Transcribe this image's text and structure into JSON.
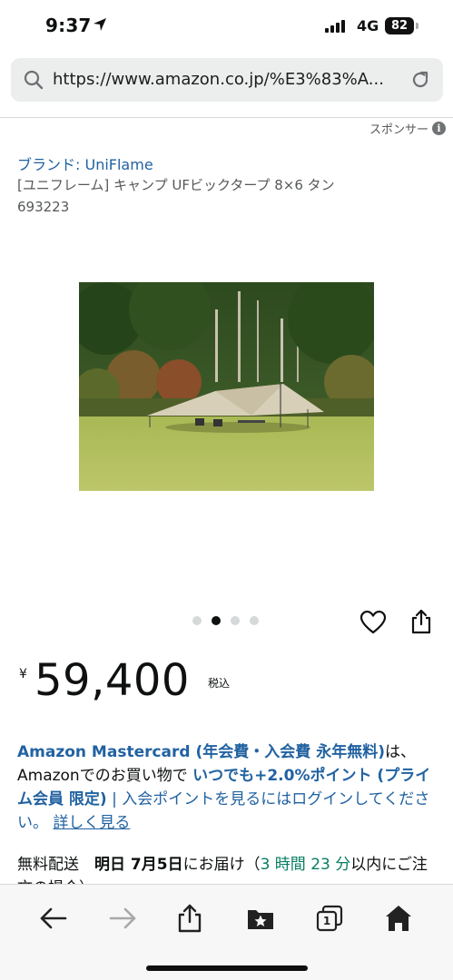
{
  "status_bar": {
    "time": "9:37",
    "network": "4G",
    "battery": "82"
  },
  "browser": {
    "url": "https://www.amazon.co.jp/%E3%83%A..."
  },
  "sponsor": {
    "label": "スポンサー",
    "info_glyph": "i"
  },
  "product": {
    "brand_link": "ブランド: UniFlame",
    "title_line1": "[ユニフレーム] キャンプ UFビックタープ 8×6 タン",
    "title_line2": "693223",
    "image_count": 4,
    "active_image": 2
  },
  "price": {
    "symbol": "¥",
    "amount": "59,400",
    "tax_note": "税込"
  },
  "promo": {
    "part1": "Amazon Mastercard (年会費・入会費 永年無料)",
    "part2": "は、Amazonでのお買い物で ",
    "part3": "いつでも+2.0%ポイント (プライム会員 限定)",
    "part4": " | 入会ポイントを見るにはログインしてください。 ",
    "link": "詳しく見る"
  },
  "delivery": {
    "label": "無料配送　",
    "date": "明日 7月5日",
    "suffix": "にお届け（",
    "countdown": "3 時間 23 分",
    "tail": "以内にご注文の場合）"
  },
  "toolbar": {
    "tabs_count": "1",
    "icons": [
      "back-icon",
      "forward-icon",
      "share-icon",
      "bookmarks-icon",
      "tabs-icon",
      "home-icon"
    ]
  },
  "colors": {
    "link": "#2162a1",
    "green": "#067d62",
    "text": "#0f1111"
  }
}
